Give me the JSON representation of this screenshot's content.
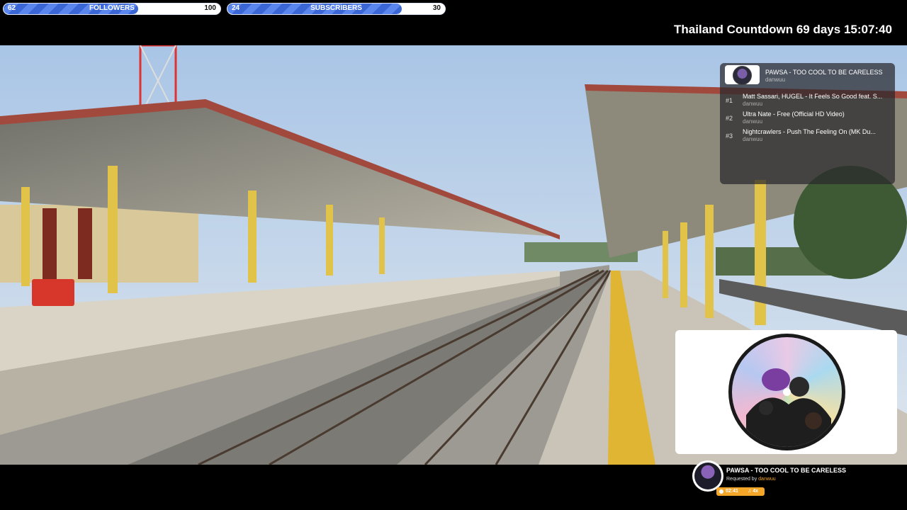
{
  "goals": {
    "followers": {
      "current": "62",
      "label": "FOLLOWERS",
      "target": "100",
      "progress": 0.62
    },
    "subscribers": {
      "current": "24",
      "label": "SUBSCRIBERS",
      "target": "30",
      "progress": 0.8
    }
  },
  "countdown": "Thailand Countdown 69 days 15:07:40",
  "queue": {
    "now": {
      "title": "PAWSA - TOO COOL TO BE CARELESS",
      "user": "danwuu"
    },
    "items": [
      {
        "rank": "#1",
        "title": "Matt Sassari, HUGEL - It Feels So Good feat. S...",
        "user": "danwuu"
      },
      {
        "rank": "#2",
        "title": "Ultra Nate - Free (Official HD Video)",
        "user": "danwuu"
      },
      {
        "rank": "#3",
        "title": "Nightcrawlers - Push The Feeling On (MK Du...",
        "user": "danwuu"
      }
    ]
  },
  "now_playing": {
    "title": "PAWSA - TOO COOL TO BE CARELESS",
    "requested_prefix": "Requested by",
    "requested_by": "danwuu",
    "time": "02:41",
    "count": "♫ 4x"
  },
  "icons": {
    "badge": "clock-icon"
  },
  "colors": {
    "accent": "#f3a628",
    "goal_fill": "#3a66d6"
  }
}
